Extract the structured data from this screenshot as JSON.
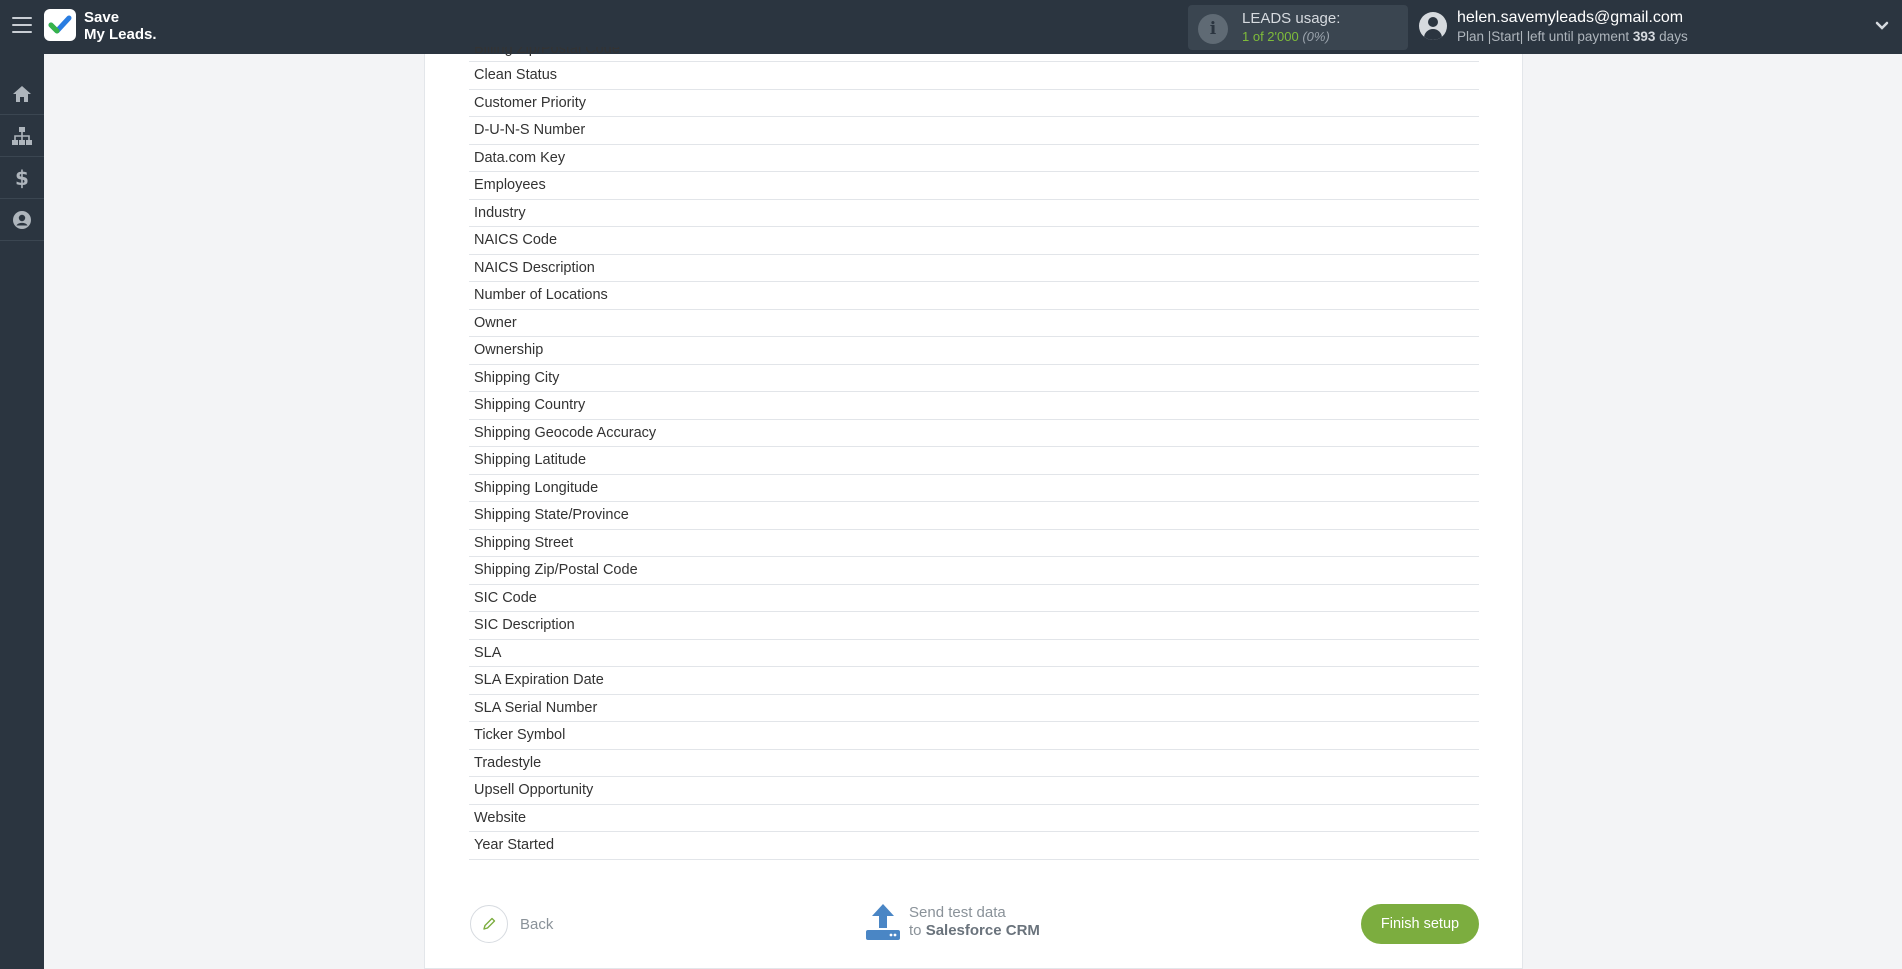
{
  "header": {
    "logo_line1": "Save",
    "logo_line2": "My Leads.",
    "usage_title": "LEADS usage:",
    "usage_count": "1 of 2'000",
    "usage_percent": "(0%)",
    "user_email": "helen.savemyleads@gmail.com",
    "plan_prefix": "Plan |Start| left until payment",
    "plan_days": "393",
    "plan_suffix": "days"
  },
  "fields": [
    "Billing Zip/Postal Code",
    "Clean Status",
    "Customer Priority",
    "D-U-N-S Number",
    "Data.com Key",
    "Employees",
    "Industry",
    "NAICS Code",
    "NAICS Description",
    "Number of Locations",
    "Owner",
    "Ownership",
    "Shipping City",
    "Shipping Country",
    "Shipping Geocode Accuracy",
    "Shipping Latitude",
    "Shipping Longitude",
    "Shipping State/Province",
    "Shipping Street",
    "Shipping Zip/Postal Code",
    "SIC Code",
    "SIC Description",
    "SLA",
    "SLA Expiration Date",
    "SLA Serial Number",
    "Ticker Symbol",
    "Tradestyle",
    "Upsell Opportunity",
    "Website",
    "Year Started"
  ],
  "footer": {
    "back_label": "Back",
    "send_line1": "Send test data",
    "send_to": "to",
    "send_target": "Salesforce CRM",
    "finish_label": "Finish setup"
  },
  "colors": {
    "topbar": "#2b3540",
    "accent_green": "#7cad3f",
    "upload_blue": "#4a86c5"
  },
  "icons": [
    "menu-icon",
    "info-icon",
    "user-icon",
    "chevron-down-icon",
    "home-icon",
    "sitemap-icon",
    "dollar-icon",
    "account-icon",
    "pencil-icon",
    "upload-icon"
  ]
}
